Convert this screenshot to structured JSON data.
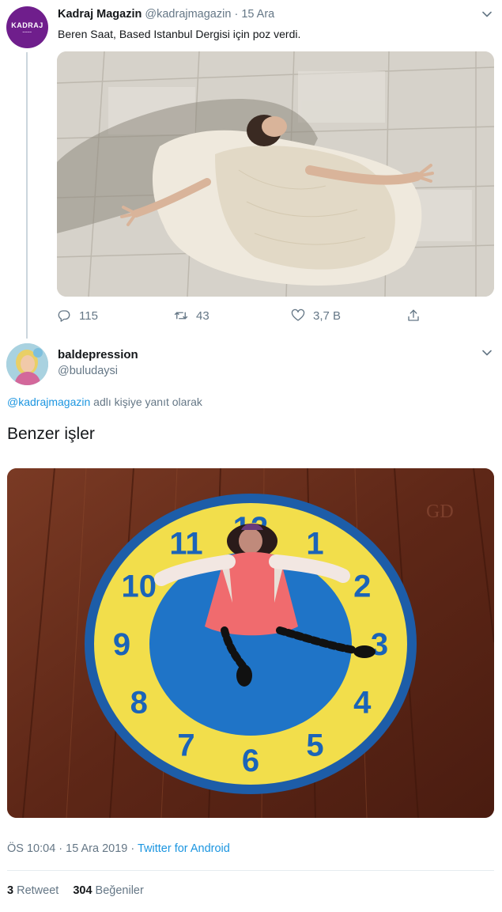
{
  "parent_tweet": {
    "avatar_logo_text": "KADRAJ",
    "author_name": "Kadraj Magazin",
    "author_handle": "@kadrajmagazin",
    "separator": "·",
    "date": "15 Ara",
    "text": "Beren Saat, Based Istanbul Dergisi için poz verdi.",
    "stats": {
      "replies": "115",
      "retweets": "43",
      "likes": "3,7 B"
    },
    "icons": [
      "reply-icon",
      "retweet-icon",
      "like-icon",
      "share-icon",
      "chevron-down-icon"
    ]
  },
  "main_tweet": {
    "author_name": "baldepression",
    "author_handle": "@buludaysi",
    "reply_mention": "@kadrajmagazin",
    "reply_suffix": " adlı kişiye yanıt olarak",
    "text": "Benzer işler",
    "timestamp": "ÖS 10:04 · 15 Ara 2019 · ",
    "client": "Twitter for Android",
    "retweet_count": "3",
    "retweet_label": "Retweet",
    "like_count": "304",
    "like_label": "Beğeniler"
  },
  "clock_numbers": [
    "12",
    "1",
    "2",
    "3",
    "4",
    "5",
    "6",
    "7",
    "8",
    "9",
    "10",
    "11"
  ],
  "colors": {
    "link": "#1b95e0",
    "secondary_text": "#657786",
    "kadraj_purple": "#6f1e8c",
    "clock_yellow": "#f2de4b",
    "clock_blue": "#1f74c7"
  }
}
